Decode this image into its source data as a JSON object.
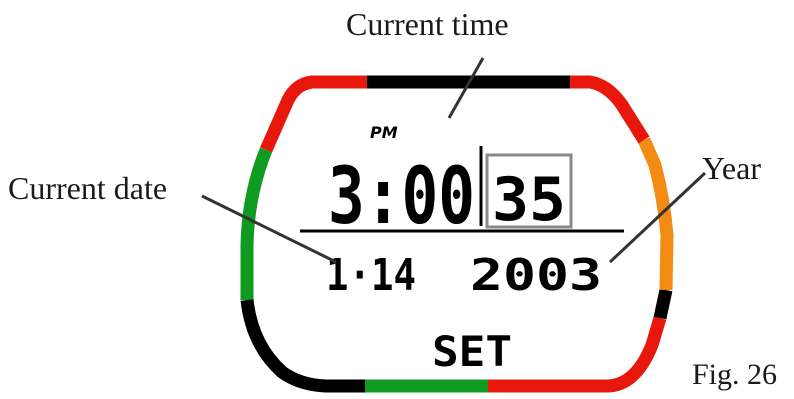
{
  "labels": {
    "current_time": "Current time",
    "current_date": "Current date",
    "year": "Year",
    "figure": "Fig. 26"
  },
  "display": {
    "meridiem": "PM",
    "time": "3:00",
    "seconds": "35",
    "date": "1·14",
    "year": "2003",
    "mode": "SET"
  },
  "bezel_colors": {
    "black": "#000000",
    "red": "#e8170c",
    "green": "#0f9b21",
    "orange": "#f38a12",
    "seconds_box": "#8a8a8a"
  }
}
